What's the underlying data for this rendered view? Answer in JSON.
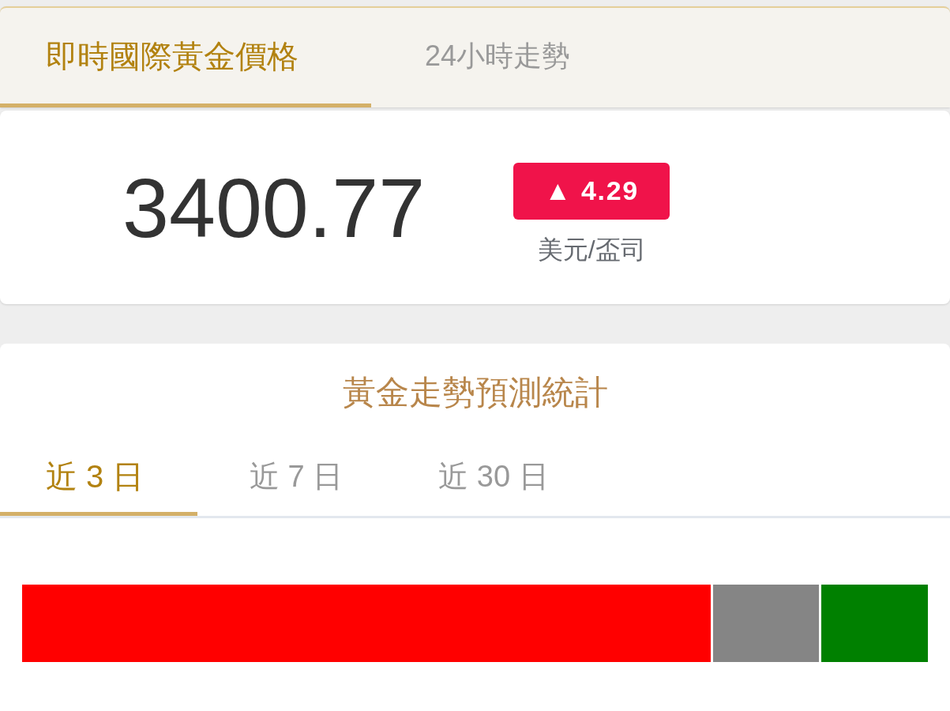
{
  "tabs": [
    {
      "label": "即時國際黃金價格",
      "selected": true
    },
    {
      "label": "24小時走勢",
      "selected": false
    }
  ],
  "price": {
    "value": "3400.77",
    "change": "▲ 4.29",
    "unit": "美元/盃司"
  },
  "forecast": {
    "title": "黃金走勢預測統計",
    "periods": [
      {
        "label": "近 3 日",
        "selected": true
      },
      {
        "label": "近 7 日",
        "selected": false
      },
      {
        "label": "近 30 日",
        "selected": false
      }
    ],
    "segments": [
      {
        "color": "#ff0000"
      },
      {
        "color": "#858585"
      },
      {
        "color": "#008000"
      }
    ]
  }
}
